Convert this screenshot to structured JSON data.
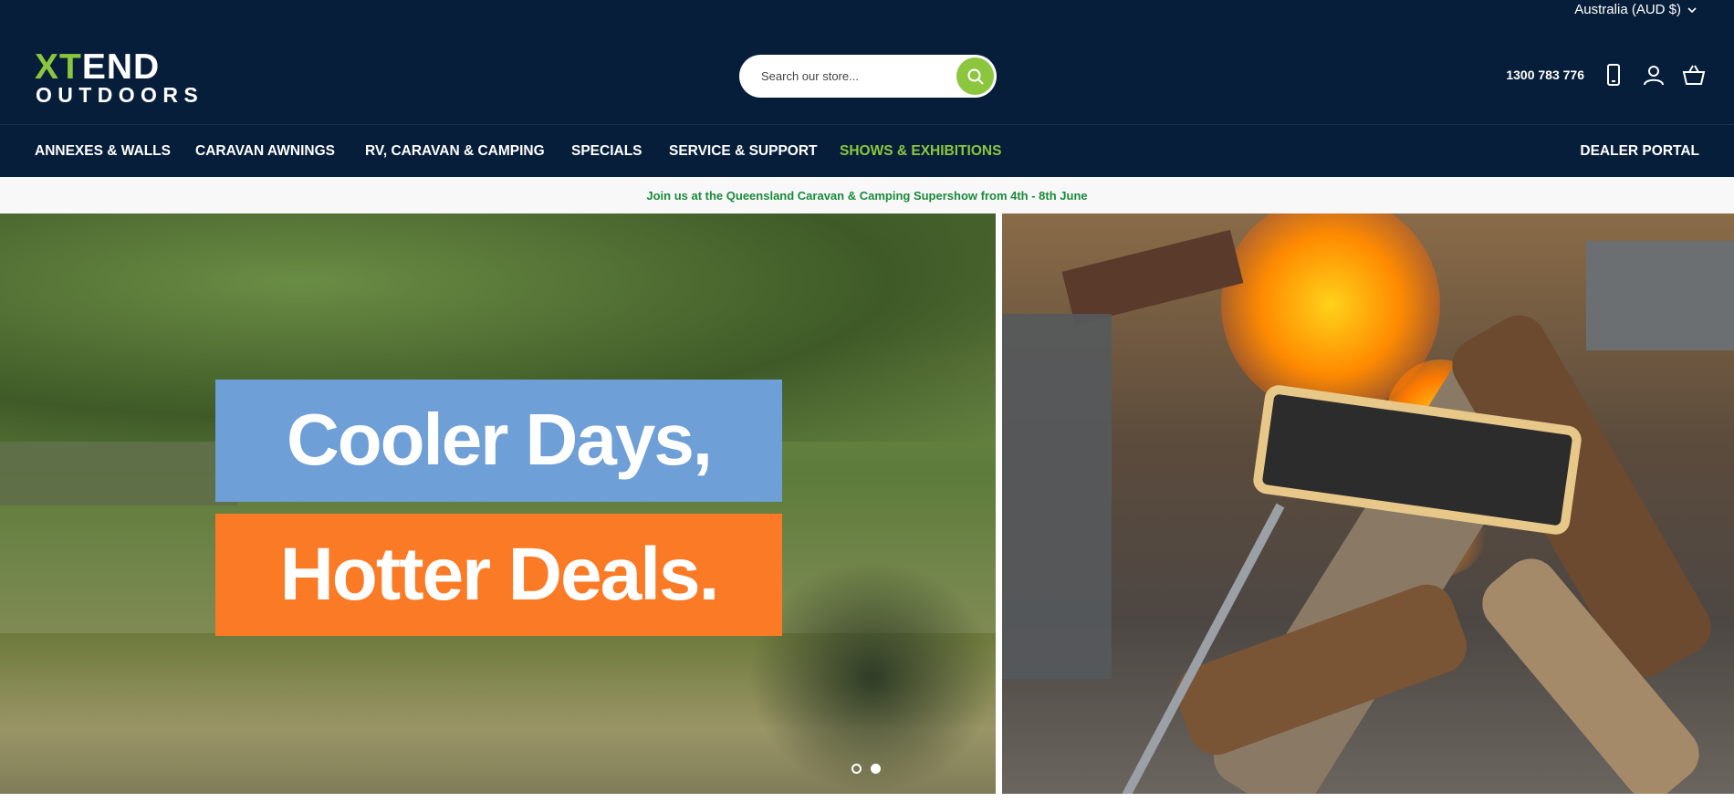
{
  "header": {
    "locale": "Australia (AUD $)",
    "logo_top": "XTEND",
    "logo_bottom": "OUTDOORS",
    "search_placeholder": "Search our store...",
    "phone": "1300 783 776",
    "icons": [
      "phone-icon",
      "account-icon",
      "cart-icon"
    ]
  },
  "nav": {
    "items": [
      {
        "label": "ANNEXES & WALLS"
      },
      {
        "label": "CARAVAN AWNINGS"
      },
      {
        "label": "RV, CARAVAN & CAMPING"
      },
      {
        "label": "SPECIALS"
      },
      {
        "label": "SERVICE & SUPPORT"
      },
      {
        "label": "SHOWS & EXHIBITIONS"
      }
    ],
    "dealer_portal": "DEALER PORTAL"
  },
  "announcement": "Join us at the Queensland Caravan & Camping Supershow from 4th - 8th June",
  "hero": {
    "line1": "Cooler Days,",
    "line2": "Hotter Deals.",
    "slides_count": 2,
    "active_slide": 1
  },
  "colors": {
    "header_bg": "#071e3a",
    "accent_green": "#8cc63f",
    "announce_text": "#1a8a3a",
    "banner_blue": "#6e9fd6",
    "banner_orange": "#fb7a25"
  }
}
